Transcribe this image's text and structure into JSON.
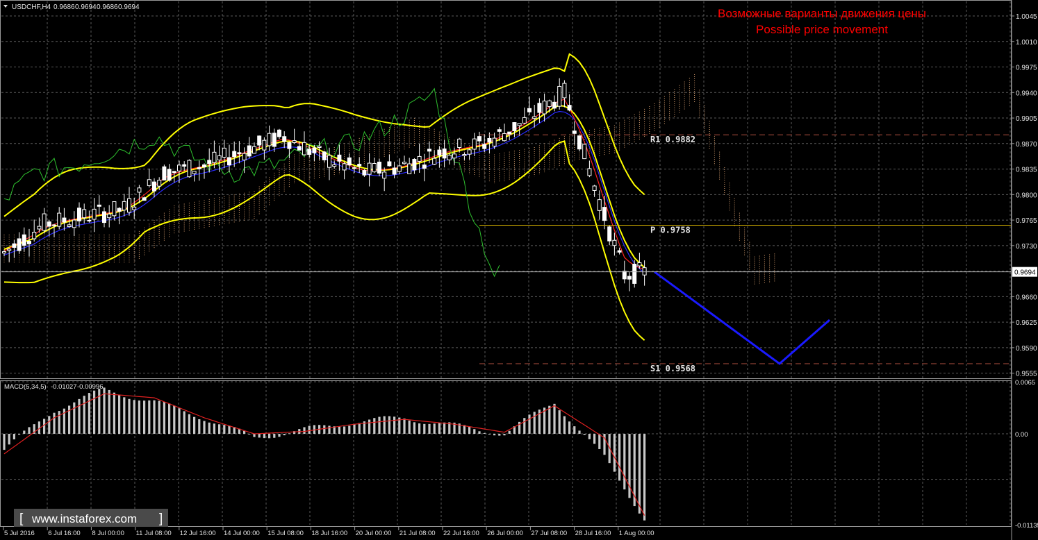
{
  "chart_data": [
    {
      "type": "line",
      "header": {
        "symbol": "USDCHF,H4",
        "ohlc": [
          "0.9686",
          "0.9694",
          "0.9686",
          "0.9694"
        ]
      },
      "title": "Возможные варианты движения цены",
      "subtitle": "Possible price movement",
      "price_axis": {
        "ylim": [
          0.9548,
          1.0065
        ],
        "ticks": [
          "1.0045",
          "1.0010",
          "0.9975",
          "0.9940",
          "0.9905",
          "0.9870",
          "0.9835",
          "0.9800",
          "0.9765",
          "0.9730",
          "0.9660",
          "0.9625",
          "0.9590",
          "0.9555"
        ],
        "current_price": "0.9694"
      },
      "time_axis": {
        "labels": [
          "5 Jul 2016",
          "6 Jul 16:00",
          "8 Jul 00:00",
          "11 Jul 08:00",
          "12 Jul 16:00",
          "14 Jul 00:00",
          "15 Jul 08:00",
          "18 Jul 16:00",
          "20 Jul 00:00",
          "21 Jul 08:00",
          "22 Jul 16:00",
          "26 Jul 00:00",
          "27 Jul 08:00",
          "28 Jul 16:00",
          "1 Aug 00:00"
        ]
      },
      "pivot_levels": [
        {
          "label": "R1",
          "value": "0.9882"
        },
        {
          "label": "P",
          "value": "0.9758"
        },
        {
          "label": "S1",
          "value": "0.9568"
        }
      ],
      "series": [
        {
          "role": "close",
          "x": [
            0,
            8,
            16,
            24,
            32,
            40,
            48,
            56,
            64,
            72,
            80,
            88,
            96,
            104,
            112,
            120,
            124,
            128
          ],
          "y": [
            0.972,
            0.976,
            0.977,
            0.978,
            0.983,
            0.984,
            0.986,
            0.988,
            0.985,
            0.983,
            0.984,
            0.986,
            0.987,
            0.99,
            0.994,
            0.977,
            0.969,
            0.9694
          ]
        },
        {
          "role": "projection",
          "x": [
            130,
            155,
            165
          ],
          "y": [
            0.9694,
            0.9568,
            0.9628
          ]
        }
      ],
      "colors": {
        "grid": "#5a5a5a",
        "candles": "#ffffff",
        "bollinger": "#ffff00",
        "tenkan": "#ff2020",
        "kijun": "#2a2aff",
        "chikou": "#2ec02e",
        "projection": "#1a1aff",
        "title": "#ff0000"
      }
    },
    {
      "type": "bar",
      "title": "MACD(5,34,5)",
      "values_label": [
        "-0.01027",
        "-0.00996"
      ],
      "ylim": [
        -0.01135,
        0.0065
      ],
      "ticks": [
        "0.0065",
        "0.00",
        "-0.01135"
      ],
      "series": [
        {
          "role": "histogram",
          "x": [
            0,
            10,
            20,
            30,
            40,
            50,
            60,
            70,
            80,
            90,
            100,
            110,
            120,
            128
          ],
          "y": [
            -0.002,
            0.003,
            0.0055,
            0.004,
            0.002,
            -0.0005,
            0.0005,
            0.0015,
            0.002,
            0.001,
            0.0,
            0.004,
            -0.003,
            -0.0105
          ]
        },
        {
          "role": "signal",
          "x": [
            0,
            10,
            20,
            30,
            40,
            50,
            60,
            70,
            80,
            90,
            100,
            110,
            120,
            128
          ],
          "y": [
            -0.0025,
            0.002,
            0.005,
            0.0045,
            0.002,
            0.0,
            0.0003,
            0.0012,
            0.0018,
            0.0012,
            0.0002,
            0.0035,
            -0.0005,
            -0.0102
          ]
        }
      ]
    }
  ],
  "watermark": "www.instaforex.com"
}
